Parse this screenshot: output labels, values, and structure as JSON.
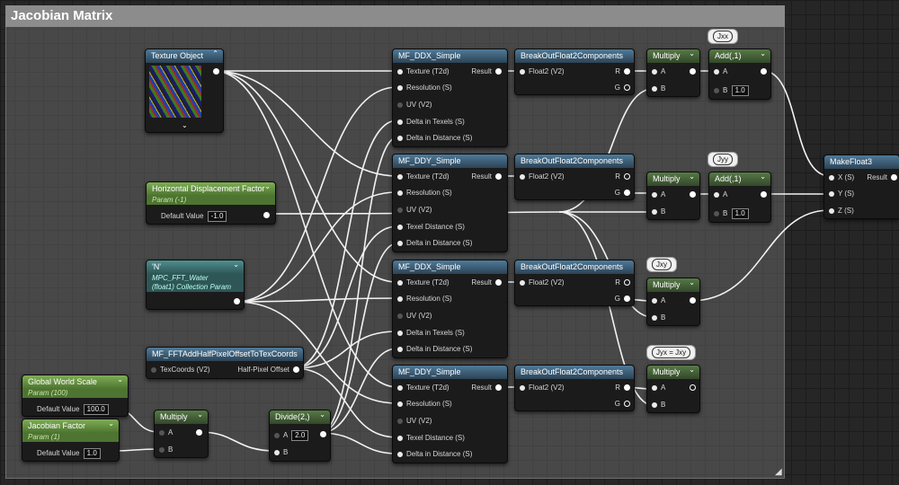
{
  "comment": {
    "title": "Jacobian Matrix"
  },
  "nodes": {
    "texture_object": {
      "title": "Texture Object"
    },
    "hdf": {
      "title": "Horizontal Displacement Factor",
      "subtitle": "Param (-1)",
      "default_label": "Default Value",
      "default_value": "-1.0"
    },
    "n_param": {
      "title": "'N'",
      "subtitle1": "MPC_FFT_Water",
      "subtitle2": "(float1) Collection Param"
    },
    "mf_half": {
      "title": "MF_FFTAddHalfPixelOffsetToTexCoords",
      "in": "TexCoords (V2)",
      "out": "Half-Pixel Offset"
    },
    "gws": {
      "title": "Global World Scale",
      "subtitle": "Param (100)",
      "default_label": "Default Value",
      "default_value": "100.0"
    },
    "jf": {
      "title": "Jacobian Factor",
      "subtitle": "Param (1)",
      "default_label": "Default Value",
      "default_value": "1.0"
    },
    "mul_bottom": {
      "title": "Multiply",
      "a": "A",
      "b": "B"
    },
    "divide": {
      "title": "Divide(2,)",
      "a": "A",
      "a_value": "2.0",
      "b": "B"
    },
    "ddx1": {
      "title": "MF_DDX_Simple",
      "pins": [
        "Texture (T2d)",
        "Resolution (S)",
        "UV (V2)",
        "Delta in Texels (S)",
        "Delta in Distance (S)"
      ],
      "result": "Result"
    },
    "ddy1": {
      "title": "MF_DDY_Simple",
      "pins": [
        "Texture (T2d)",
        "Resolution (S)",
        "UV (V2)",
        "Texel Distance (S)",
        "Delta in Distance (S)"
      ],
      "result": "Result"
    },
    "ddx2": {
      "title": "MF_DDX_Simple",
      "pins": [
        "Texture (T2d)",
        "Resolution (S)",
        "UV (V2)",
        "Delta in Texels (S)",
        "Delta in Distance (S)"
      ],
      "result": "Result"
    },
    "ddy2": {
      "title": "MF_DDY_Simple",
      "pins": [
        "Texture (T2d)",
        "Resolution (S)",
        "UV (V2)",
        "Texel Distance (S)",
        "Delta in Distance (S)"
      ],
      "result": "Result"
    },
    "bo1": {
      "title": "BreakOutFloat2Components",
      "in": "Float2 (V2)",
      "r": "R",
      "g": "G"
    },
    "bo2": {
      "title": "BreakOutFloat2Components",
      "in": "Float2 (V2)",
      "r": "R",
      "g": "G"
    },
    "bo3": {
      "title": "BreakOutFloat2Components",
      "in": "Float2 (V2)",
      "r": "R",
      "g": "G"
    },
    "bo4": {
      "title": "BreakOutFloat2Components",
      "in": "Float2 (V2)",
      "r": "R",
      "g": "G"
    },
    "mul1": {
      "title": "Multiply",
      "a": "A",
      "b": "B"
    },
    "mul2": {
      "title": "Multiply",
      "a": "A",
      "b": "B"
    },
    "mul3": {
      "title": "Multiply",
      "a": "A",
      "b": "B"
    },
    "mul4": {
      "title": "Multiply",
      "a": "A",
      "b": "B"
    },
    "add1": {
      "title": "Add(,1)",
      "a": "A",
      "b": "B",
      "b_value": "1.0"
    },
    "add2": {
      "title": "Add(,1)",
      "a": "A",
      "b": "B",
      "b_value": "1.0"
    },
    "makefloat3": {
      "title": "MakeFloat3",
      "x": "X (S)",
      "y": "Y (S)",
      "z": "Z (S)",
      "result": "Result"
    }
  },
  "bubbles": {
    "jxx": "Jxx",
    "jyy": "Jyy",
    "jxy": "Jxy",
    "jyx": "Jyx = Jxy"
  },
  "colors": {
    "graph_bg": "#262626",
    "comment_title": "#8c8c8c",
    "header_blue": "#3d5d75",
    "header_green": "#6a9a45",
    "wire": "#ffffff"
  }
}
